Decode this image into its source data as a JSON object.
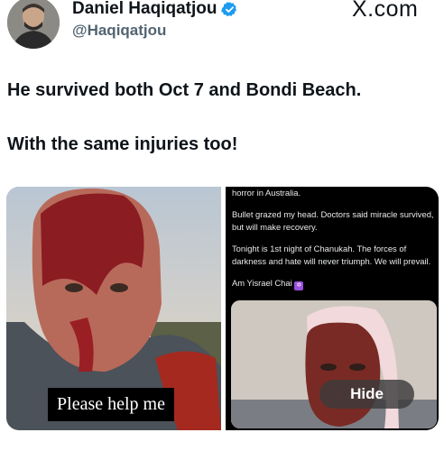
{
  "author": {
    "name": "Daniel Haqiqatjou",
    "handle": "@Haqiqatjou",
    "verified": true,
    "verified_color": "#1d9bf0"
  },
  "brand": {
    "logo_text": "X.com"
  },
  "post": {
    "line1": "He survived both Oct 7 and Bondi Beach.",
    "line2": "With the same injuries too!"
  },
  "media": {
    "left_caption": "Please help me",
    "right_post": {
      "p1": "horror in Australia.",
      "p2": "Bullet grazed my head. Doctors said miracle survived, but will make recovery.",
      "p3": "Tonight is 1st night of Chanukah. The forces of darkness and hate will never triumph. We will prevail.",
      "p4": "Am Yisrael Chai"
    },
    "hide_button": "Hide"
  }
}
